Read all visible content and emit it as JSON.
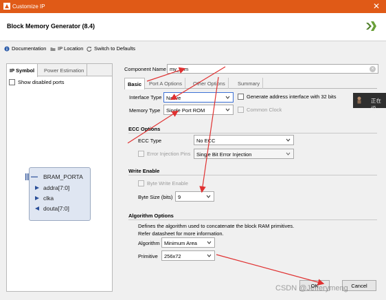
{
  "window": {
    "title": "Customize IP",
    "close_glyph": "✕"
  },
  "header": {
    "title": "Block Memory Generator (8.4)"
  },
  "toolbar": {
    "documentation": "Documentation",
    "ip_location": "IP Location",
    "switch_defaults": "Switch to Defaults"
  },
  "left": {
    "tabs": [
      "IP Symbol",
      "Power Estimation"
    ],
    "show_disabled_ports": "Show disabled ports",
    "symbol": {
      "port_name": "BRAM_PORTA",
      "pins": [
        "addra[7:0]",
        "clka",
        "douta[7:0]"
      ]
    }
  },
  "component": {
    "label": "Component Name",
    "value": "my_rom"
  },
  "tabs": [
    "Basic",
    "Port A Options",
    "Other Options",
    "Summary"
  ],
  "basic": {
    "interface_type_label": "Interface Type",
    "interface_type_value": "Native",
    "memory_type_label": "Memory Type",
    "memory_type_value": "Single Port ROM",
    "gen_addr_label": "Generate address interface with 32 bits",
    "common_clock_label": "Common Clock"
  },
  "ecc": {
    "section": "ECC Options",
    "ecc_type_label": "ECC Type",
    "ecc_type_value": "No ECC",
    "error_injection_label": "Error Injection Pins",
    "error_injection_value": "Single Bit Error Injection"
  },
  "write_enable": {
    "section": "Write Enable",
    "byte_write_label": "Byte Write Enable",
    "byte_size_label": "Byte Size (bits)",
    "byte_size_value": "9"
  },
  "algorithm": {
    "section": "Algorithm Options",
    "desc1": "Defines the algorithm used to concatenate the block RAM primitives.",
    "desc2": "Refer datasheet for more information.",
    "algorithm_label": "Algorithm",
    "algorithm_value": "Minimum Area",
    "primitive_label": "Primitive",
    "primitive_value": "256x72"
  },
  "buttons": {
    "ok": "OK",
    "cancel": "Cancel"
  },
  "popup": {
    "text": "正在说"
  },
  "watermark": "CSDN @Jefferymeng",
  "colors": {
    "titlebar": "#e05a17",
    "arrow": "#e03030",
    "focus": "#3b70d6"
  }
}
